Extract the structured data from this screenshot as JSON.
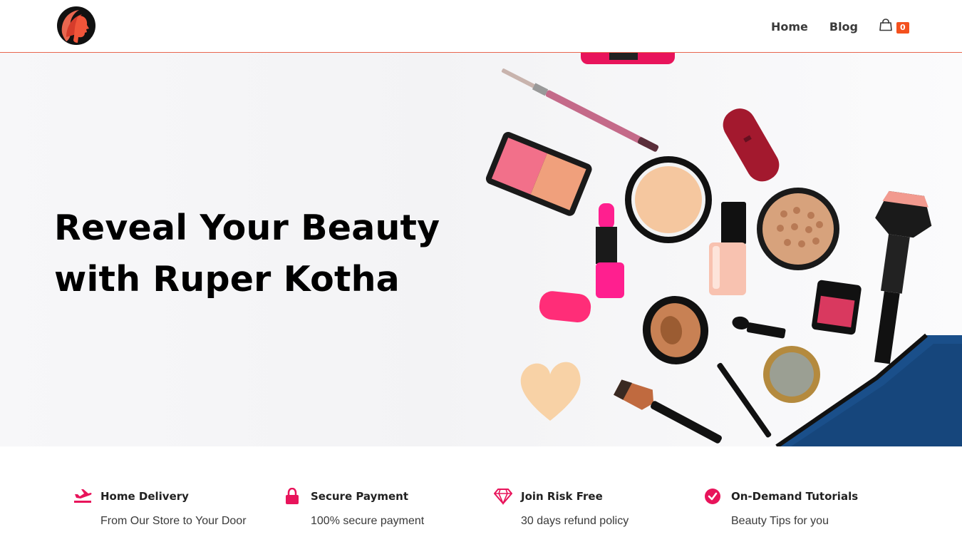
{
  "brand": {
    "logo_icon": "woman-profile-logo-icon",
    "colors": {
      "accent": "#e8664f",
      "pink": "#e8145b",
      "cart_badge": "#f4511e"
    }
  },
  "nav": {
    "items": [
      {
        "label": "Home"
      },
      {
        "label": "Blog"
      }
    ],
    "cart": {
      "icon": "shopping-bag-icon",
      "count": "0"
    }
  },
  "hero": {
    "title_line1": "Reveal Your Beauty",
    "title_line2": "with Ruper Kotha",
    "image": "cosmetics-flatlay-image"
  },
  "features": [
    {
      "icon": "airplane-delivery-icon",
      "title": "Home Delivery",
      "subtitle": "From Our Store to Your Door"
    },
    {
      "icon": "lock-icon",
      "title": "Secure Payment",
      "subtitle": "100% secure payment"
    },
    {
      "icon": "diamond-icon",
      "title": "Join Risk Free",
      "subtitle": "30 days refund policy"
    },
    {
      "icon": "check-circle-icon",
      "title": "On-Demand Tutorials",
      "subtitle": "Beauty Tips for you"
    }
  ]
}
